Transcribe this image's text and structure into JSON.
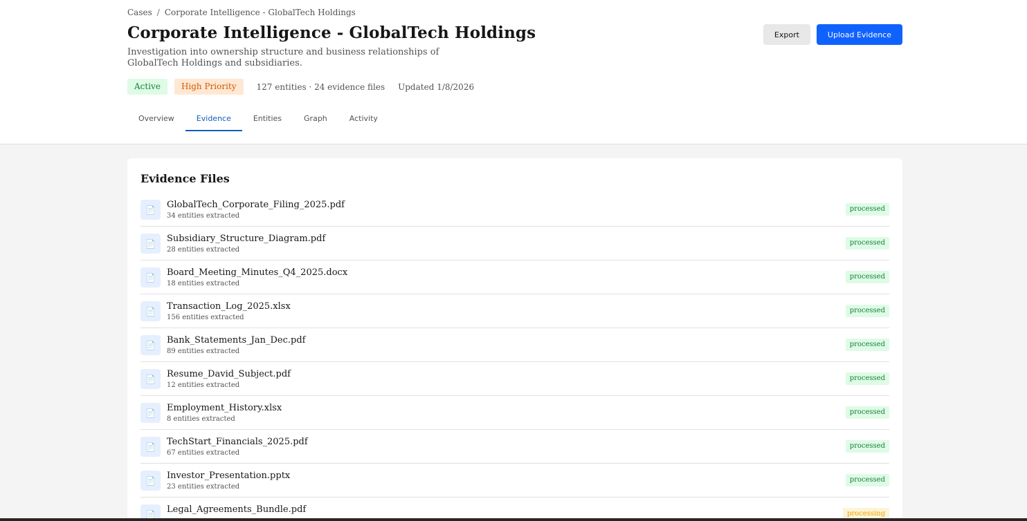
{
  "breadcrumb": {
    "root": "Cases",
    "separator": "/",
    "current": "Corporate Intelligence - GlobalTech Holdings"
  },
  "case": {
    "title": "Corporate Intelligence - GlobalTech Holdings",
    "description": "Investigation into ownership structure and business relationships of GlobalTech Holdings and subsidiaries.",
    "status_tag": "Active",
    "priority_tag": "High Priority",
    "counts": "127 entities · 24 evidence files",
    "updated": "Updated 1/8/2026"
  },
  "actions": {
    "export_label": "Export",
    "upload_label": "Upload Evidence"
  },
  "tabs": [
    {
      "label": "Overview",
      "active": false
    },
    {
      "label": "Evidence",
      "active": true
    },
    {
      "label": "Entities",
      "active": false
    },
    {
      "label": "Graph",
      "active": false
    },
    {
      "label": "Activity",
      "active": false
    }
  ],
  "evidence": {
    "title": "Evidence Files",
    "file_icon": "document-icon",
    "files": [
      {
        "name": "GlobalTech_Corporate_Filing_2025.pdf",
        "entities": "34 entities extracted",
        "status": "processed"
      },
      {
        "name": "Subsidiary_Structure_Diagram.pdf",
        "entities": "28 entities extracted",
        "status": "processed"
      },
      {
        "name": "Board_Meeting_Minutes_Q4_2025.docx",
        "entities": "18 entities extracted",
        "status": "processed"
      },
      {
        "name": "Transaction_Log_2025.xlsx",
        "entities": "156 entities extracted",
        "status": "processed"
      },
      {
        "name": "Bank_Statements_Jan_Dec.pdf",
        "entities": "89 entities extracted",
        "status": "processed"
      },
      {
        "name": "Resume_David_Subject.pdf",
        "entities": "12 entities extracted",
        "status": "processed"
      },
      {
        "name": "Employment_History.xlsx",
        "entities": "8 entities extracted",
        "status": "processed"
      },
      {
        "name": "TechStart_Financials_2025.pdf",
        "entities": "67 entities extracted",
        "status": "processed"
      },
      {
        "name": "Investor_Presentation.pptx",
        "entities": "23 entities extracted",
        "status": "processed"
      },
      {
        "name": "Legal_Agreements_Bundle.pdf",
        "entities": "",
        "status": "processing"
      }
    ]
  },
  "colors": {
    "primary": "#0f62fe",
    "active_tab": "#0f5dbb",
    "success_bg": "#defbe6",
    "success_text": "#198038",
    "warning_bg": "#ffe8d3",
    "warning_text": "#d45800"
  }
}
